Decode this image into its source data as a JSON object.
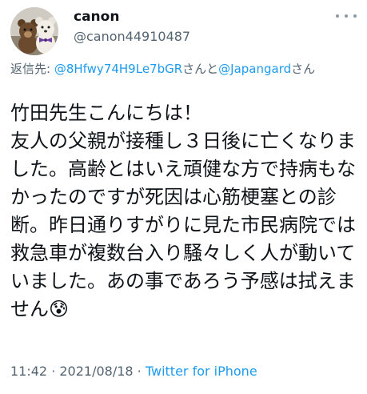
{
  "user": {
    "display_name": "canon",
    "handle": "@canon44910487",
    "avatar_icon": "teddy-bears-avatar"
  },
  "reply": {
    "prefix": "返信先: ",
    "mention_1": "@8Hfwy74H9Le7bGR",
    "connector_1": "さんと",
    "mention_2": "@Japangard",
    "suffix": "さん"
  },
  "tweet": {
    "text": "竹田先生こんにちは！\n友人の父親が接種し３日後に亡くなりました。高齢とはいえ頑健な方で持病もなかったのですが死因は心筋梗塞との診断。昨日通りすがりに見た市民病院では救急車が複数台入り騒々しく人が動いていました。あの事であろう予感は拭えません😰"
  },
  "meta": {
    "time": "11:42",
    "separator_1": " · ",
    "date": "2021/08/18",
    "separator_2": " · ",
    "source": "Twitter for iPhone"
  },
  "colors": {
    "link": "#1d9bf0",
    "secondary": "#536471",
    "text": "#0f1419"
  }
}
